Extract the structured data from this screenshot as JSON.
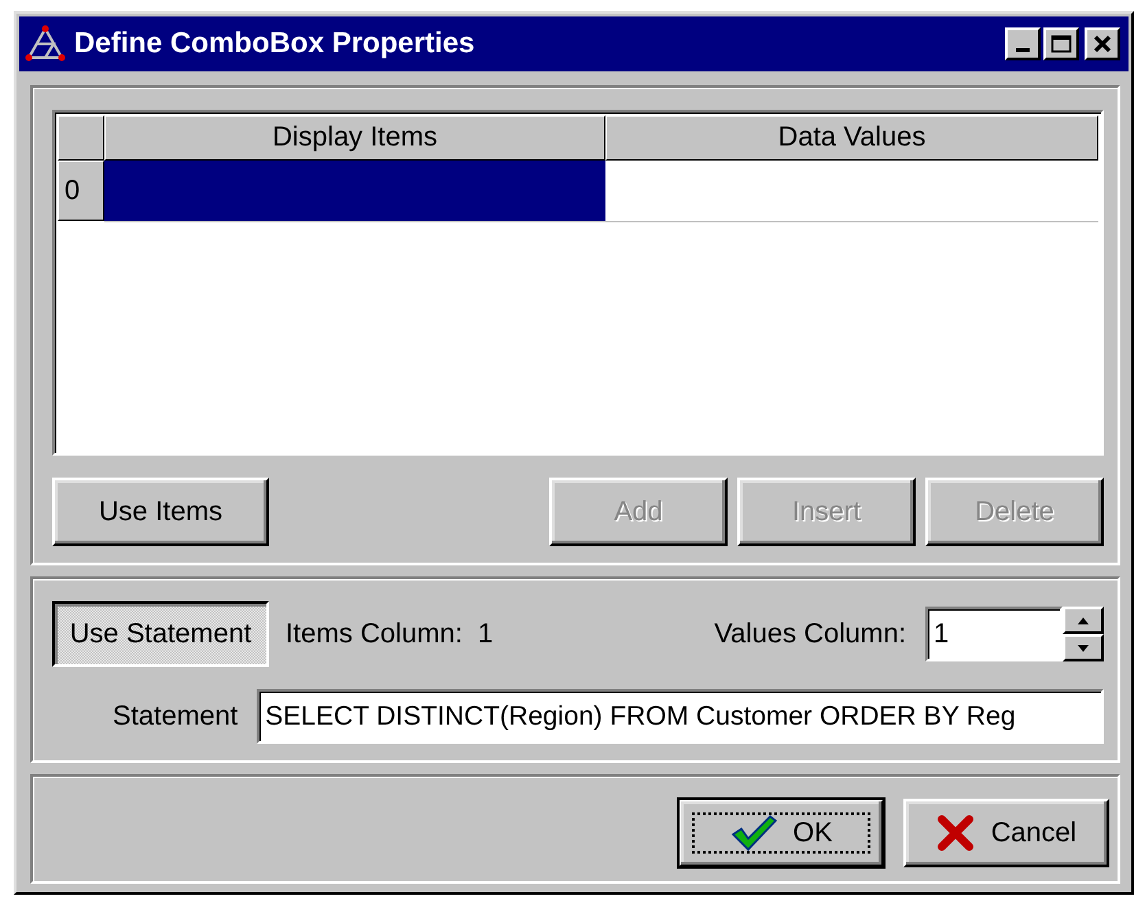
{
  "window": {
    "title": "Define ComboBox Properties"
  },
  "grid": {
    "columns": [
      "Display Items",
      "Data Values"
    ],
    "rows": [
      {
        "label": "0",
        "cells": [
          {
            "selected": true
          },
          {
            "selected": false
          }
        ]
      }
    ]
  },
  "item_buttons": [
    {
      "label": "Use Items",
      "disabled": false
    },
    {
      "label": "Add",
      "disabled": true
    },
    {
      "label": "Insert",
      "disabled": true
    },
    {
      "label": "Delete",
      "disabled": true
    }
  ],
  "statement_panel": {
    "use_statement": {
      "label": "Use Statement",
      "pressed": true
    },
    "items_column": {
      "label": "Items Column:",
      "value": "1"
    },
    "values_column": {
      "label": "Values Column:",
      "value": "1"
    },
    "statement": {
      "label": "Statement",
      "value": "SELECT DISTINCT(Region) FROM Customer ORDER BY Reg"
    }
  },
  "dialog_buttons": [
    {
      "label": "OK",
      "kind": "ok",
      "default": true
    },
    {
      "label": "Cancel",
      "kind": "cancel",
      "default": false
    }
  ]
}
